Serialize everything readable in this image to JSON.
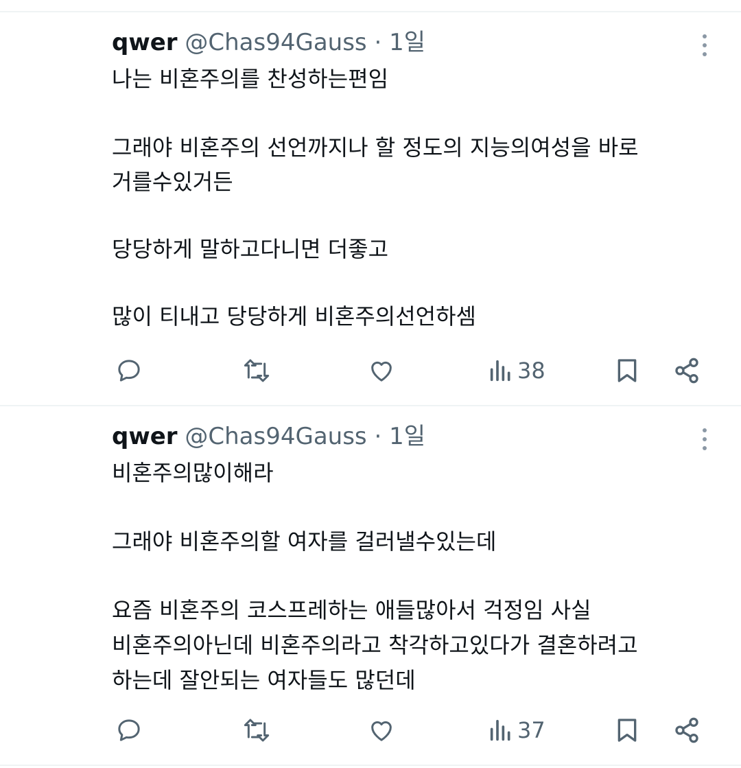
{
  "tweets": [
    {
      "name": "qwer",
      "handle": "@Chas94Gauss",
      "separator": "·",
      "time": "1일",
      "lines": [
        "나는 비혼주의를 찬성하는편임",
        "그래야 비혼주의 선언까지나 할 정도의 지능의여성을 바로",
        "거를수있거든",
        "당당하게 말하고다니면 더좋고",
        "많이 티내고 당당하게 비혼주의선언하셈"
      ],
      "views": "38"
    },
    {
      "name": "qwer",
      "handle": "@Chas94Gauss",
      "separator": "·",
      "time": "1일",
      "lines": [
        "비혼주의많이해라",
        "그래야 비혼주의할 여자를 걸러낼수있는데",
        "요즘 비혼주의 코스프레하는 애들많아서 걱정임 사실",
        "비혼주의아닌데 비혼주의라고 착각하고있다가 결혼하려고",
        "하는데 잘안되는 여자들도 많던데"
      ],
      "views": "37"
    }
  ],
  "icons": [
    "reply-icon",
    "retweet-icon",
    "like-icon",
    "views-icon",
    "bookmark-icon",
    "share-icon",
    "more-icon"
  ],
  "colors": {
    "text": "#0f1419",
    "secondary": "#536471",
    "divider": "#eff3f4"
  }
}
